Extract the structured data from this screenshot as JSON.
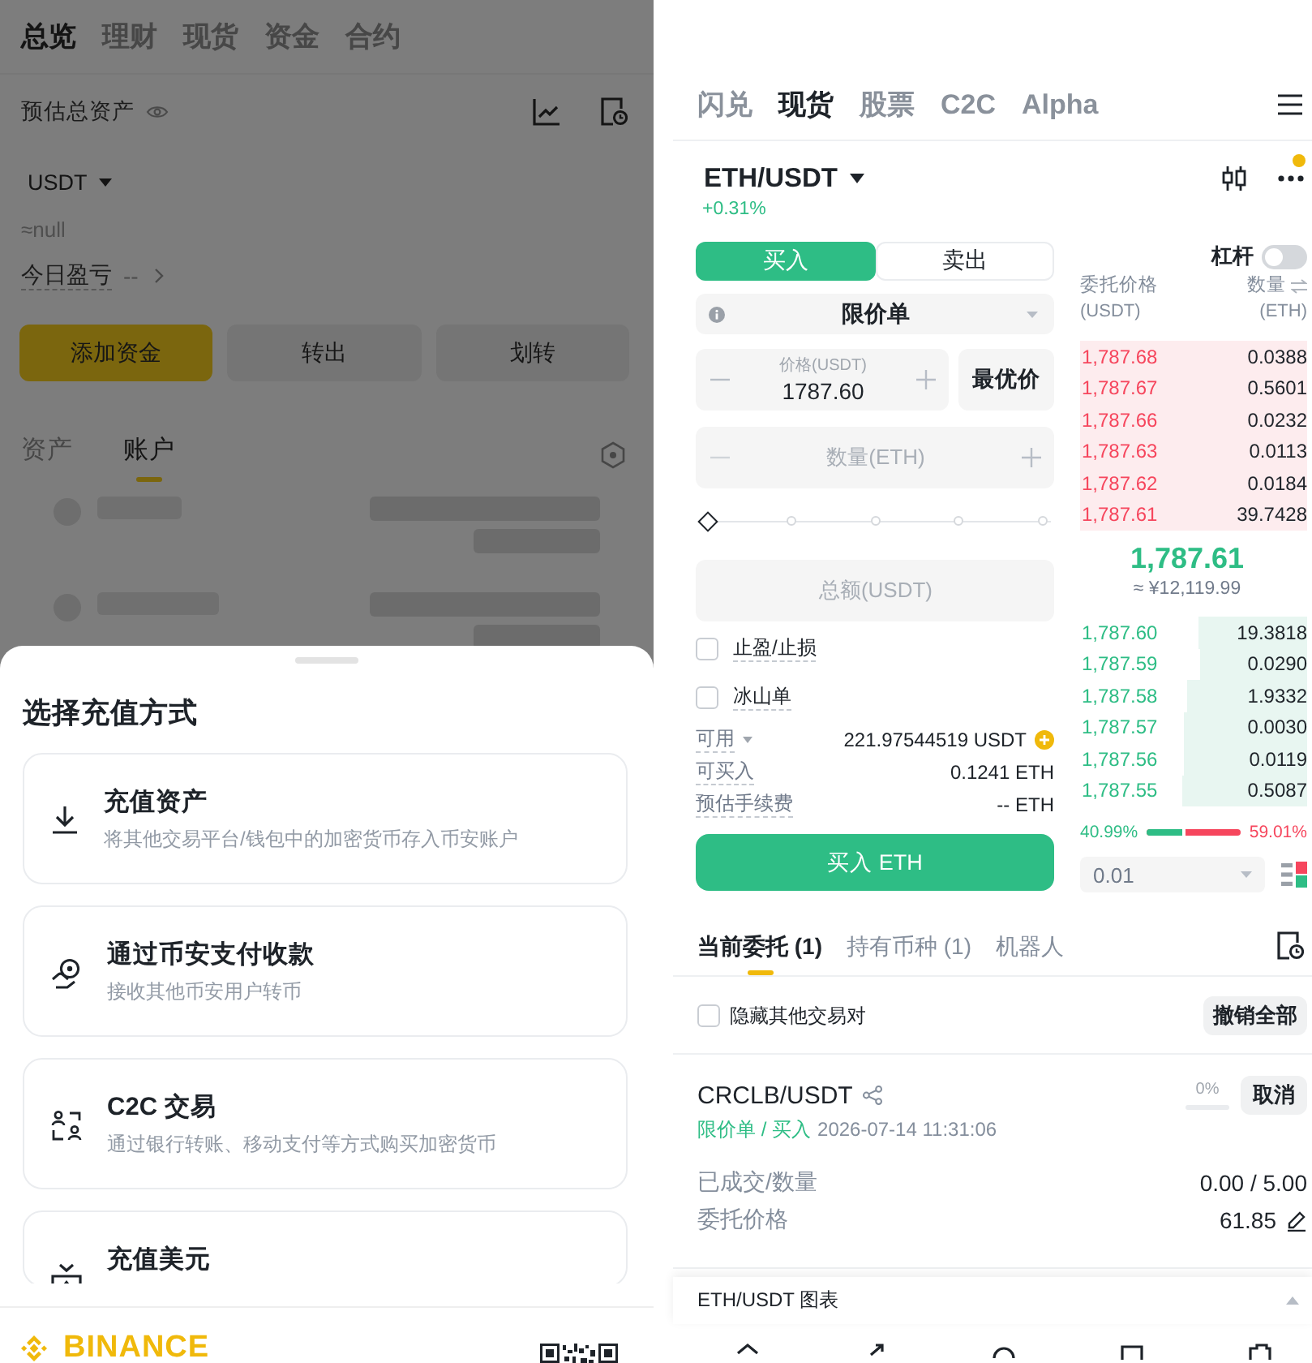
{
  "left_screen": {
    "tabs": [
      {
        "label": "总览",
        "selected": true
      },
      {
        "label": "理财",
        "selected": false
      },
      {
        "label": "现货",
        "selected": false
      },
      {
        "label": "资金",
        "selected": false
      },
      {
        "label": "合约",
        "selected": false
      }
    ],
    "balance": {
      "label": "预估总资产",
      "currency": "USDT",
      "approx": "≈null",
      "pnl_label": "今日盈亏",
      "pnl_value": "--"
    },
    "actions": [
      {
        "kind": "primary",
        "label": "添加资金"
      },
      {
        "kind": "secondary",
        "label": "转出"
      },
      {
        "kind": "secondary",
        "label": "划转"
      }
    ],
    "sub_tabs": [
      {
        "label": "资产",
        "selected": false
      },
      {
        "label": "账户",
        "selected": true
      }
    ]
  },
  "deposit_sheet": {
    "title": "选择充值方式",
    "options": [
      {
        "kind": "download",
        "title": "充值资产",
        "description": "将其他交易平台/钱包中的加密货币存入币安账户"
      },
      {
        "kind": "receive",
        "title": "通过币安支付收款",
        "description": "接收其他币安用户转币"
      },
      {
        "kind": "c2c",
        "title": "C2C 交易",
        "description": "通过银行转账、移动支付等方式购买加密货币"
      },
      {
        "kind": "fiat",
        "title": "充值美元"
      }
    ],
    "brand": "BINANCE"
  },
  "right_screen": {
    "tabs": [
      {
        "label": "闪兑",
        "selected": false
      },
      {
        "label": "现货",
        "selected": true
      },
      {
        "label": "股票",
        "selected": false
      },
      {
        "label": "C2C",
        "selected": false
      },
      {
        "label": "Alpha",
        "selected": false
      }
    ],
    "pair": {
      "symbol": "ETH/USDT",
      "change": "+0.31%",
      "notification": true
    },
    "order_form": {
      "sides": [
        {
          "label": "买入",
          "selected": true
        },
        {
          "label": "卖出",
          "selected": false
        }
      ],
      "order_type": "限价单",
      "price": {
        "label": "价格(USDT)",
        "value": "1787.60"
      },
      "best_price": "最优价",
      "quantity": {
        "placeholder": "数量(ETH)"
      },
      "amount_slider": {
        "level": 0
      },
      "total": {
        "placeholder": "总额(USDT)"
      },
      "options": [
        {
          "label": "止盈/止损",
          "checked": false
        },
        {
          "label": "冰山单",
          "checked": false
        }
      ],
      "info": [
        {
          "kind": "balance",
          "label": "可用",
          "value": "221.97544519 USDT"
        },
        {
          "kind": "plain",
          "label": "可买入",
          "value": "0.1241 ETH"
        },
        {
          "kind": "plain",
          "label": "预估手续费",
          "value": "-- ETH"
        }
      ],
      "submit": "买入 ETH"
    },
    "order_book": {
      "leverage": {
        "label": "杠杆",
        "on": false
      },
      "price_column": {
        "title": "委托价格",
        "unit": "(USDT)"
      },
      "amount_column": {
        "title": "数量",
        "unit": "(ETH)"
      },
      "asks": [
        {
          "price": "1,787.68",
          "amount": "0.0388",
          "level": 1
        },
        {
          "price": "1,787.67",
          "amount": "0.5601",
          "level": 1
        },
        {
          "price": "1,787.66",
          "amount": "0.0232",
          "level": 1
        },
        {
          "price": "1,787.63",
          "amount": "0.0113",
          "level": 1
        },
        {
          "price": "1,787.62",
          "amount": "0.0184",
          "level": 1
        },
        {
          "price": "1,787.61",
          "amount": "39.7428",
          "level": 1
        }
      ],
      "last_price": "1,787.61",
      "last_price_fiat": "≈ ¥12,119.99",
      "bids": [
        {
          "price": "1,787.60",
          "amount": "19.3818",
          "level": 0.48
        },
        {
          "price": "1,787.59",
          "amount": "0.0290",
          "level": 0.47
        },
        {
          "price": "1,787.58",
          "amount": "1.9332",
          "level": 0.53
        },
        {
          "price": "1,787.57",
          "amount": "0.0030",
          "level": 0.54
        },
        {
          "price": "1,787.56",
          "amount": "0.0119",
          "level": 0.54
        },
        {
          "price": "1,787.55",
          "amount": "0.5087",
          "level": 0.55
        }
      ],
      "ratio": {
        "buy": "40.99%",
        "sell": "59.01%",
        "level": 0.41
      },
      "precision": "0.01"
    },
    "orders": {
      "tabs": [
        {
          "label": "当前委托 (1)",
          "selected": true
        },
        {
          "label": "持有币种 (1)",
          "selected": false
        },
        {
          "label": "机器人",
          "selected": false
        }
      ],
      "hide_other_pairs": {
        "label": "隐藏其他交易对",
        "checked": false
      },
      "cancel_all": "撤销全部",
      "items": [
        {
          "pair": "CRCLB/USDT",
          "progress": "0%",
          "level": 0,
          "cancel": "取消",
          "type": "限价单 / 买入",
          "time": "2026-07-14 11:31:06",
          "fields": [
            {
              "label": "已成交/数量",
              "value": "0.00 / 5.00",
              "editable": false
            },
            {
              "label": "委托价格",
              "value": "61.85",
              "editable": true
            }
          ]
        }
      ]
    },
    "chart_panel": {
      "title": "ETH/USDT 图表"
    }
  }
}
